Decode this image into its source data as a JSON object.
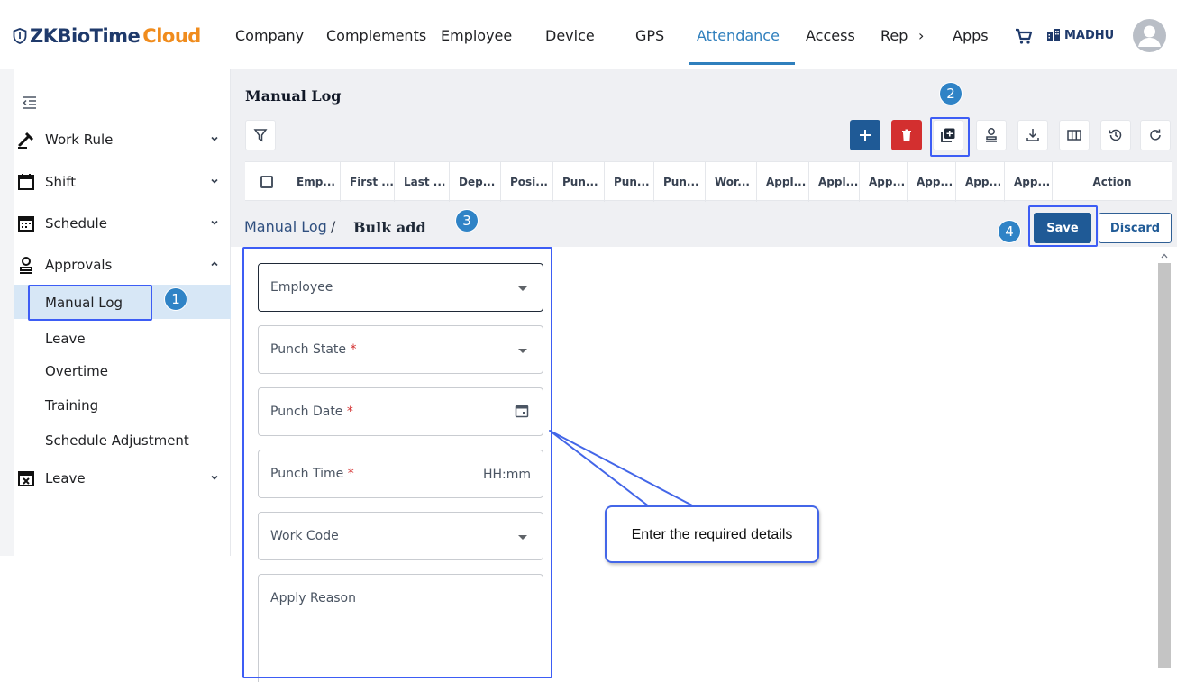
{
  "brand": {
    "prefix": "ZKBioTime",
    "suffix": "Cloud"
  },
  "nav": {
    "items": [
      "Company",
      "Complements",
      "Employee",
      "Device",
      "GPS",
      "Attendance",
      "Access",
      "Rep",
      "Apps"
    ],
    "more": "›",
    "active": "Attendance",
    "user": "MADHU"
  },
  "sidebar": {
    "items": [
      {
        "label": "Work Rule",
        "icon": "work-rule-icon"
      },
      {
        "label": "Shift",
        "icon": "calendar-icon"
      },
      {
        "label": "Schedule",
        "icon": "schedule-icon"
      },
      {
        "label": "Approvals",
        "icon": "approvals-icon"
      }
    ],
    "sub_items": [
      "Manual Log",
      "Leave",
      "Overtime",
      "Training",
      "Schedule Adjustment"
    ],
    "active_sub": "Manual Log",
    "bottom_item": {
      "label": "Leave",
      "icon": "leave-calendar-icon"
    }
  },
  "page": {
    "title": "Manual Log",
    "columns": [
      "Emp...",
      "First ...",
      "Last ...",
      "Dep...",
      "Posi...",
      "Pun...",
      "Pun...",
      "Pun...",
      "Wor...",
      "Appl...",
      "Appl...",
      "App...",
      "App...",
      "App...",
      "App...",
      "Action"
    ],
    "toolbar_icons": [
      "add-icon",
      "delete-icon",
      "bulk-add-icon",
      "approve-icon",
      "download-icon",
      "columns-icon",
      "history-icon",
      "refresh-icon"
    ]
  },
  "breadcrumb": {
    "parent": "Manual Log",
    "separator": "/",
    "current": "Bulk add"
  },
  "actions": {
    "save": "Save",
    "discard": "Discard"
  },
  "form": {
    "employee": "Employee",
    "punch_state": "Punch State",
    "punch_date": "Punch Date",
    "punch_time": "Punch Time",
    "punch_time_placeholder": "HH:mm",
    "work_code": "Work Code",
    "apply_reason": "Apply Reason",
    "required_mark": "*"
  },
  "annotations": {
    "badges": [
      "1",
      "2",
      "3",
      "4"
    ],
    "callout": "Enter the required details"
  },
  "colors": {
    "accent": "#2f7fbd",
    "primary": "#1f5a96",
    "danger": "#d32f2f",
    "highlight": "#3d5df5",
    "brand_orange": "#f08c1d"
  }
}
